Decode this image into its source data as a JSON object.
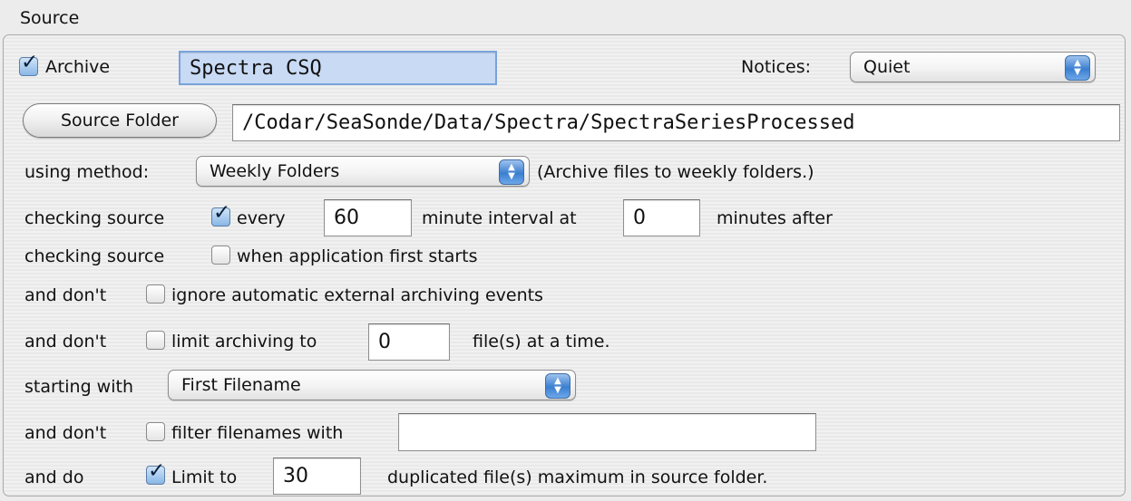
{
  "section": {
    "title": "Source"
  },
  "archive": {
    "label": "Archive",
    "checked": true,
    "name_value": "Spectra CSQ"
  },
  "notices": {
    "label": "Notices:",
    "selected": "Quiet"
  },
  "source_folder": {
    "button_label": "Source Folder",
    "path": "/Codar/SeaSonde/Data/Spectra/SpectraSeriesProcessed"
  },
  "method": {
    "label": "using method:",
    "selected": "Weekly Folders",
    "description": "(Archive files to weekly folders.)"
  },
  "checking_interval": {
    "prefix": "checking source",
    "checked": true,
    "every_label": "every",
    "minutes_value": "60",
    "interval_label": "minute interval at",
    "offset_value": "0",
    "after_label": "minutes after"
  },
  "checking_startup": {
    "prefix": "checking source",
    "checked": false,
    "label": "when application first starts"
  },
  "ignore_events": {
    "prefix": "and don't",
    "checked": false,
    "label": "ignore automatic external archiving events"
  },
  "limit_archiving": {
    "prefix": "and don't",
    "checked": false,
    "label": "limit archiving to",
    "value": "0",
    "suffix": "file(s) at a time."
  },
  "starting_with": {
    "label": "starting with",
    "selected": "First Filename"
  },
  "filter": {
    "prefix": "and don't",
    "checked": false,
    "label": "filter filenames with",
    "value": ""
  },
  "duplicates": {
    "prefix": "and do",
    "checked": true,
    "label": "Limit to",
    "value": "30",
    "suffix": "duplicated file(s) maximum in source folder."
  },
  "icons": {
    "checkmark": "checkmark-icon",
    "popup_arrows": "up-down-arrows-icon"
  }
}
